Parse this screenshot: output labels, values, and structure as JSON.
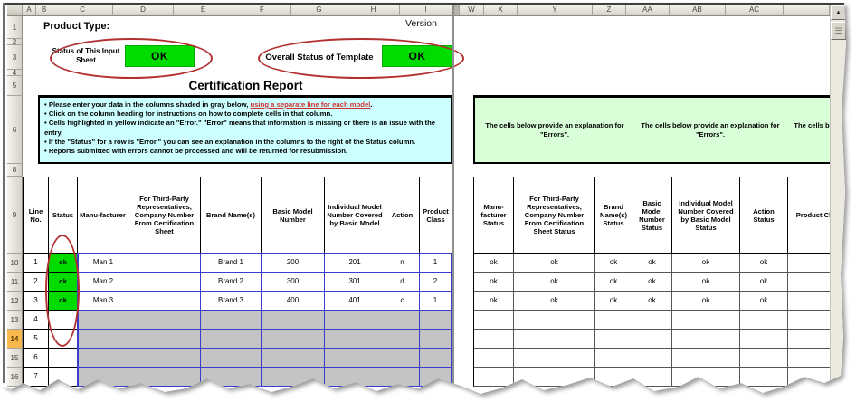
{
  "sheet": {
    "product_type_label": "Product Type:",
    "version_label": "Version",
    "input_status_label": "Status of This Input Sheet",
    "input_status_value": "OK",
    "overall_status_label": "Overall Status of Template",
    "overall_status_value": "OK",
    "title": "Certification Report"
  },
  "grid": {
    "left_columns": [
      "A",
      "B",
      "C",
      "D",
      "E",
      "F",
      "G",
      "H",
      "I"
    ],
    "right_columns": [
      "W",
      "X",
      "Y",
      "Z",
      "AA",
      "AB",
      "AC"
    ],
    "rows": [
      "1",
      "2",
      "3",
      "4",
      "5",
      "6",
      "8",
      "9",
      "10",
      "11",
      "12",
      "13",
      "14",
      "15",
      "16"
    ],
    "selected_row": "14"
  },
  "instructions": {
    "b1_pre": "• Please enter your data in the columns shaded in gray below, ",
    "b1_link": "using a separate line for each model",
    "b1_post": ".",
    "b2": "• Click on the column heading for instructions on how to complete cells in that column.",
    "b3": "• Cells highlighted in yellow indicate an \"Error.\"  \"Error\" means that information is missing or there is an issue with the entry.",
    "b4": "• If the \"Status\" for a row is \"Error,\" you can see an explanation in the columns to the right of the Status column.",
    "b5": "• Reports submitted with errors cannot be processed and will be returned for resubmission."
  },
  "error_explanation": {
    "notes": [
      "The cells below provide an explanation for \"Errors\".",
      "The cells below provide an explanation for \"Errors\".",
      "The cells below provide an explanation for \"Errors\"."
    ]
  },
  "left_table": {
    "headers": [
      "Line No.",
      "Status",
      "Manu-facturer",
      "For Third-Party Representatives, Company Number From Certification Sheet",
      "Brand Name(s)",
      "Basic Model Number",
      "Individual Model Number Covered by Basic Model",
      "Action",
      "Product Class"
    ],
    "rows": [
      {
        "cells": [
          "1",
          "ok",
          "Man 1",
          "",
          "Brand 1",
          "200",
          "201",
          "n",
          "1"
        ]
      },
      {
        "cells": [
          "2",
          "ok",
          "Man 2",
          "",
          "Brand 2",
          "300",
          "301",
          "d",
          "2"
        ]
      },
      {
        "cells": [
          "3",
          "ok",
          "Man 3",
          "",
          "Brand 3",
          "400",
          "401",
          "c",
          "1"
        ]
      },
      {
        "cells": [
          "4",
          "",
          "",
          "",
          "",
          "",
          "",
          "",
          ""
        ]
      },
      {
        "cells": [
          "5",
          "",
          "",
          "",
          "",
          "",
          "",
          "",
          ""
        ]
      },
      {
        "cells": [
          "6",
          "",
          "",
          "",
          "",
          "",
          "",
          "",
          ""
        ]
      },
      {
        "cells": [
          "7",
          "",
          "",
          "",
          "",
          "",
          "",
          "",
          ""
        ]
      }
    ]
  },
  "right_table": {
    "headers": [
      "Manu-facturer Status",
      "For Third-Party Representatives, Company Number From Certification Sheet Status",
      "Brand Name(s) Status",
      "Basic Model Number Status",
      "Individual Model Number Covered by Basic Model Status",
      "Action Status",
      "Product Class Status"
    ],
    "rows": [
      {
        "cells": [
          "ok",
          "ok",
          "ok",
          "ok",
          "ok",
          "ok",
          ""
        ]
      },
      {
        "cells": [
          "ok",
          "ok",
          "ok",
          "ok",
          "ok",
          "ok",
          ""
        ]
      },
      {
        "cells": [
          "ok",
          "ok",
          "ok",
          "ok",
          "ok",
          "ok",
          ""
        ]
      },
      {
        "cells": [
          "",
          "",
          "",
          "",
          "",
          "",
          ""
        ]
      },
      {
        "cells": [
          "",
          "",
          "",
          "",
          "",
          "",
          ""
        ]
      },
      {
        "cells": [
          "",
          "",
          "",
          "",
          "",
          "",
          ""
        ]
      },
      {
        "cells": [
          "",
          "",
          "",
          "",
          "",
          "",
          ""
        ]
      }
    ]
  },
  "colors": {
    "status_ok_green": "#00dc00",
    "gray_input_cell": "#c4c4c4",
    "instruction_box_bg": "#ccffff",
    "explanation_box_bg": "#d9ffd9",
    "annotation_red": "#b23030",
    "grid_blue": "#3c3ccd",
    "selected_row_header": "#f8b84e",
    "link_red": "#d03030"
  }
}
